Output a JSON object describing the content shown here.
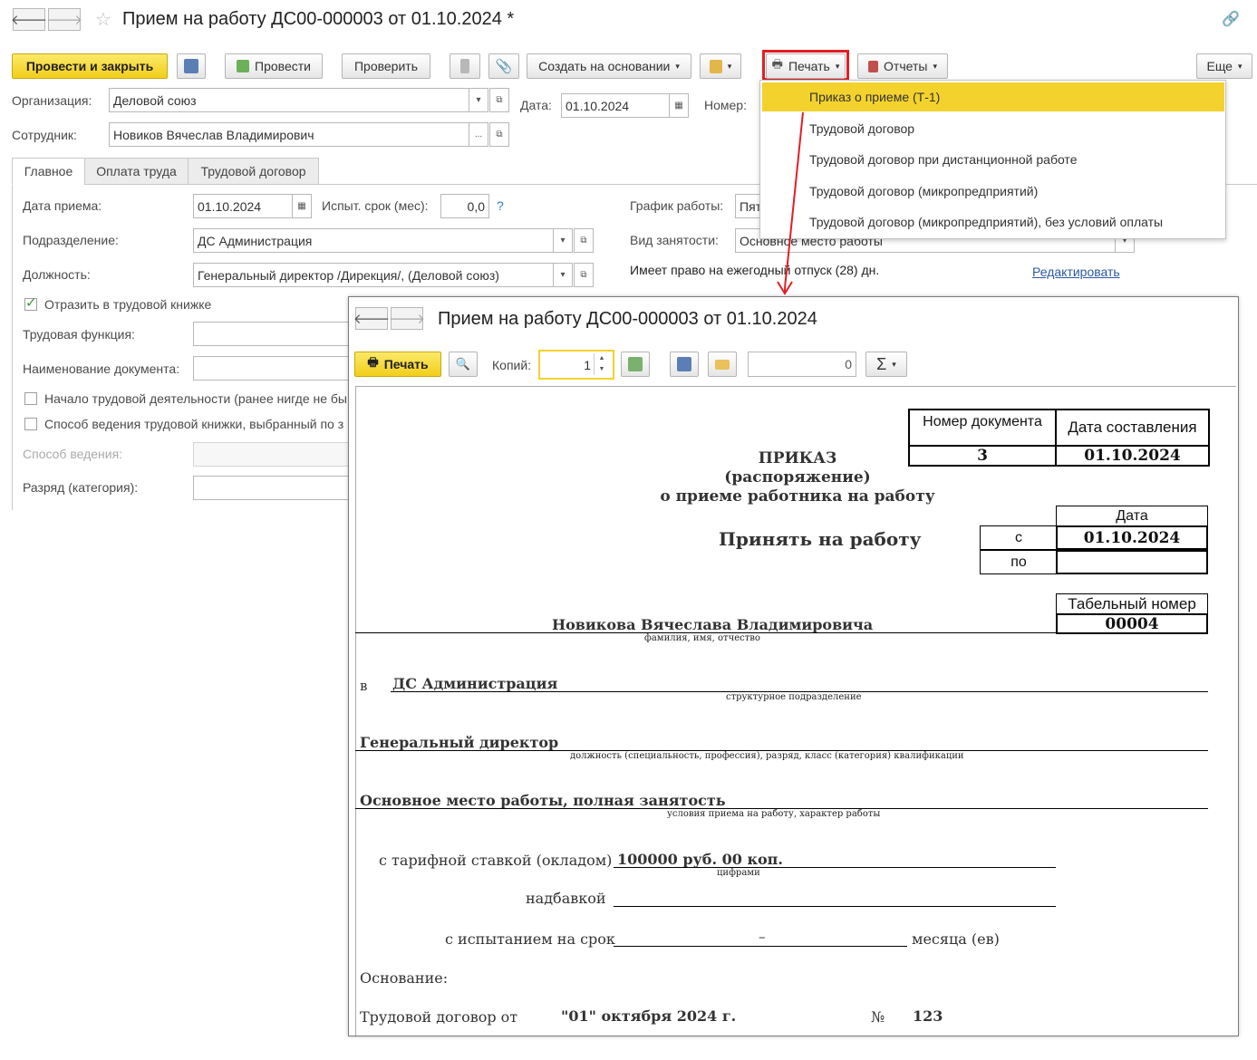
{
  "title": "Прием на работу ДС00-000003 от 01.10.2024 *",
  "toolbar": {
    "post_close": "Провести и закрыть",
    "post": "Провести",
    "check": "Проверить",
    "create_based": "Создать на основании",
    "print": "Печать",
    "reports": "Отчеты",
    "more": "Еще"
  },
  "header": {
    "org_label": "Организация:",
    "org_value": "Деловой союз",
    "date_label": "Дата:",
    "date_value": "01.10.2024",
    "number_label": "Номер:",
    "employee_label": "Сотрудник:",
    "employee_value": "Новиков Вячеслав Владимирович",
    "ellipsis": "..."
  },
  "tabs": [
    "Главное",
    "Оплата труда",
    "Трудовой договор"
  ],
  "main": {
    "hire_date_label": "Дата приема:",
    "hire_date_value": "01.10.2024",
    "probation_label": "Испыт. срок (мес):",
    "probation_value": "0,0",
    "help": "?",
    "schedule_label": "График работы:",
    "schedule_value": "Пят",
    "dept_label": "Подразделение:",
    "dept_value": "ДС Администрация",
    "employment_label": "Вид занятости:",
    "employment_value": "Основное место работы",
    "position_label": "Должность:",
    "position_value": "Генеральный директор /Дирекция/, (Деловой союз)",
    "vacation_text": "Имеет право на ежегодный отпуск (28) дн.",
    "edit_link": "Редактировать",
    "workbook_cb": "Отразить в трудовой книжке",
    "labor_function_label": "Трудовая функция:",
    "doc_name_label": "Наименование документа:",
    "start_activity_cb": "Начало трудовой деятельности (ранее нигде не бы",
    "workbook_method_cb": "Способ ведения трудовой книжки, выбранный по з",
    "method_label": "Способ ведения:",
    "category_label": "Разряд (категория):"
  },
  "print_menu": [
    "Приказ о приеме (Т-1)",
    "Трудовой договор",
    "Трудовой договор при дистанционной работе",
    "Трудовой договор (микропредприятий)",
    "Трудовой договор (микропредприятий), без условий оплаты"
  ],
  "preview": {
    "title": "Прием на работу ДС00-000003 от 01.10.2024",
    "print_btn": "Печать",
    "copies_label": "Копий:",
    "copies_value": "1",
    "sum_value": "0",
    "sigma": "Σ"
  },
  "doc": {
    "docnum_header": "Номер документа",
    "date_header": "Дата составления",
    "docnum_value": "3",
    "date_value": "01.10.2024",
    "order_title1": "ПРИКАЗ",
    "order_title2": "(распоряжение)",
    "order_title3": "о приеме работника на работу",
    "hire_title": "Принять на работу",
    "date_col": "Дата",
    "from_label": "с",
    "from_value": "01.10.2024",
    "to_label": "по",
    "tabnum_header": "Табельный номер",
    "tabnum_value": "00004",
    "employee_name": "Новикова Вячеслава Владимировича",
    "fio_caption": "фамилия, имя, отчество",
    "in_label": "в",
    "dept": "ДС Администрация",
    "dept_caption": "структурное подразделение",
    "position": "Генеральный директор",
    "position_caption": "должность (специальность, профессия), разряд, класс (категория) квалификации",
    "conditions": "Основное место работы, полная занятость",
    "conditions_caption": "условия приема на работу, характер работы",
    "rate_label": "с тарифной ставкой (окладом)",
    "rate_value": "100000 руб. 00 коп.",
    "rate_caption": "цифрами",
    "bonus_label": "надбавкой",
    "probation_label": "с испытанием на срок",
    "probation_value": "–",
    "months_label": "месяца (ев)",
    "basis_label": "Основание:",
    "contract_label": "Трудовой договор от",
    "contract_date": "\"01\" октября 2024 г.",
    "no_label": "№",
    "contract_no": "123"
  },
  "colors": {
    "accent_yellow": "#f3d22e",
    "highlight_red": "#e31e24",
    "link_blue": "#2c5aa0"
  }
}
